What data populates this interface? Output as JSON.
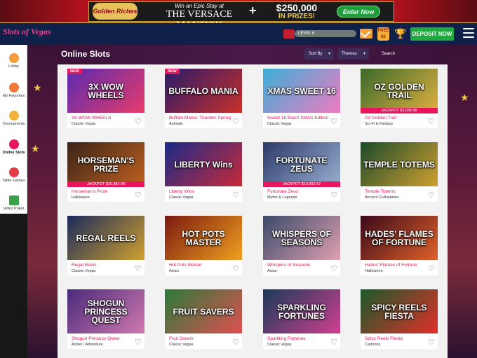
{
  "promo": {
    "logo_text": "Golden Riches",
    "win_text": "Win an Epic Stay at",
    "mansion_text": "THE VERSACE MANSION",
    "plus": "+",
    "amount": "$250,000",
    "prizes": "IN PRIZES!",
    "cta": "Enter Now"
  },
  "nav": {
    "logo": "Slots of Vegas",
    "level": "LEVEL 6",
    "free_label": "FREE",
    "free_label2": "$5",
    "trophy": "🏆",
    "deposit": "DEPOSIT NOW"
  },
  "sidebar": {
    "items": [
      {
        "label": "Lobby",
        "color": "#f39c3c"
      },
      {
        "label": "My Favorites",
        "color": "#f07a3a"
      },
      {
        "label": "Tournaments",
        "color": "#f2b33c"
      },
      {
        "label": "Online Slots",
        "color": "#e8175d"
      },
      {
        "label": "Table Games",
        "color": "#e23c4a"
      },
      {
        "label": "Video Poker",
        "color": "#3aa24a"
      }
    ]
  },
  "page": {
    "title": "Online Slots",
    "sort_label": "Sort By",
    "themes_label": "Themes",
    "search_label": "Search"
  },
  "games": [
    {
      "name": "3X WOW WHEELS",
      "category": "Classic Vegas",
      "thumb": "3X WOW WHEELS",
      "badge": "NEW",
      "jackpot": "",
      "bg": "#5a2bb0",
      "bg2": "#e63c6a"
    },
    {
      "name": "Buffalo Mania: Thunder Springs",
      "category": "Animals",
      "thumb": "BUFFALO MANIA",
      "badge": "NEW",
      "jackpot": "",
      "bg": "#2a1a6a",
      "bg2": "#c8302a"
    },
    {
      "name": "Sweet 16 Blast! XMAS Edition",
      "category": "Classic Vegas",
      "thumb": "XMAS SWEET 16",
      "badge": "",
      "jackpot": "",
      "bg": "#3ab0d8",
      "bg2": "#f07ac0"
    },
    {
      "name": "Oz Golden Trail",
      "category": "Sci-Fi & Fantasy",
      "thumb": "OZ GOLDEN TRAIL",
      "badge": "",
      "jackpot": "JACKPOT $3,039.96",
      "bg": "#3a6a2a",
      "bg2": "#e0b040"
    },
    {
      "name": "Horseman's Prize",
      "category": "Halloween",
      "thumb": "HORSEMAN'S PRIZE",
      "badge": "",
      "jackpot": "JACKPOT $35,982.40",
      "bg": "#3a2418",
      "bg2": "#c06020"
    },
    {
      "name": "Liberty Wins",
      "category": "Classic Vegas",
      "thumb": "LIBERTY Wins",
      "badge": "",
      "jackpot": "",
      "bg": "#1a2a8a",
      "bg2": "#c82a3a"
    },
    {
      "name": "Fortunate Zeus",
      "category": "Myths & Legends",
      "thumb": "FORTUNATE ZEUS",
      "badge": "",
      "jackpot": "JACKPOT $10,692.67",
      "bg": "#2a3a6a",
      "bg2": "#9ab0d0"
    },
    {
      "name": "Temple Totems",
      "category": "Ancient Civilizations",
      "thumb": "TEMPLE TOTEMS",
      "badge": "",
      "jackpot": "",
      "bg": "#1a4a2a",
      "bg2": "#d0a030"
    },
    {
      "name": "Regal Reels",
      "category": "Classic Vegas",
      "thumb": "REGAL REELS",
      "badge": "",
      "jackpot": "",
      "bg": "#1a2a5a",
      "bg2": "#d0a030"
    },
    {
      "name": "Hot Pots Master",
      "category": "Asian",
      "thumb": "HOT POTS MASTER",
      "badge": "",
      "jackpot": "",
      "bg": "#7a1a10",
      "bg2": "#f0a020"
    },
    {
      "name": "Whispers of Seasons",
      "category": "Asian",
      "thumb": "WHISPERS OF SEASONS",
      "badge": "",
      "jackpot": "",
      "bg": "#3a4a6a",
      "bg2": "#e0a0b0"
    },
    {
      "name": "Hades' Flames of Fortune",
      "category": "Halloween",
      "thumb": "HADES' FLAMES OF FORTUNE",
      "badge": "",
      "jackpot": "",
      "bg": "#3a0a1a",
      "bg2": "#e0602a"
    },
    {
      "name": "Shogun Princess Quest",
      "category": "Action / Adventure",
      "thumb": "SHOGUN PRINCESS QUEST",
      "badge": "",
      "jackpot": "",
      "bg": "#4a2a7a",
      "bg2": "#d07ab0"
    },
    {
      "name": "Fruit Savers",
      "category": "Classic Vegas",
      "thumb": "FRUIT SAVERS",
      "badge": "",
      "jackpot": "",
      "bg": "#2a7a3a",
      "bg2": "#e05050"
    },
    {
      "name": "Sparkling Fortunes",
      "category": "Classic Vegas",
      "thumb": "SPARKLING FORTUNES",
      "badge": "",
      "jackpot": "",
      "bg": "#1a3a5a",
      "bg2": "#d04090"
    },
    {
      "name": "Spicy Reels Fiesta",
      "category": "Cartoons",
      "thumb": "SPICY REELS FIESTA",
      "badge": "",
      "jackpot": "",
      "bg": "#1a5a2a",
      "bg2": "#e0302a"
    }
  ]
}
